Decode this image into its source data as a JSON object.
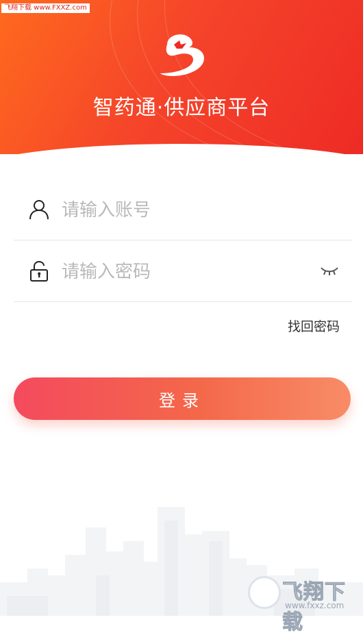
{
  "watermark_top": "飞翔下载 www.FXXZ.com",
  "app_title": "智药通·供应商平台",
  "account": {
    "placeholder": "请输入账号",
    "value": ""
  },
  "password": {
    "placeholder": "请输入密码",
    "value": ""
  },
  "forgot_label": "找回密码",
  "login_label": "登录",
  "watermark_bottom": {
    "brand": "飞翔下载",
    "url": "www.fxxz.com"
  },
  "colors": {
    "brand_red": "#ee2b25",
    "brand_orange": "#ff6a1e",
    "button_start": "#f44a5e",
    "button_end": "#f88c67"
  },
  "icons": [
    "app-logo-icon",
    "user-icon",
    "lock-icon",
    "eye-closed-icon"
  ]
}
